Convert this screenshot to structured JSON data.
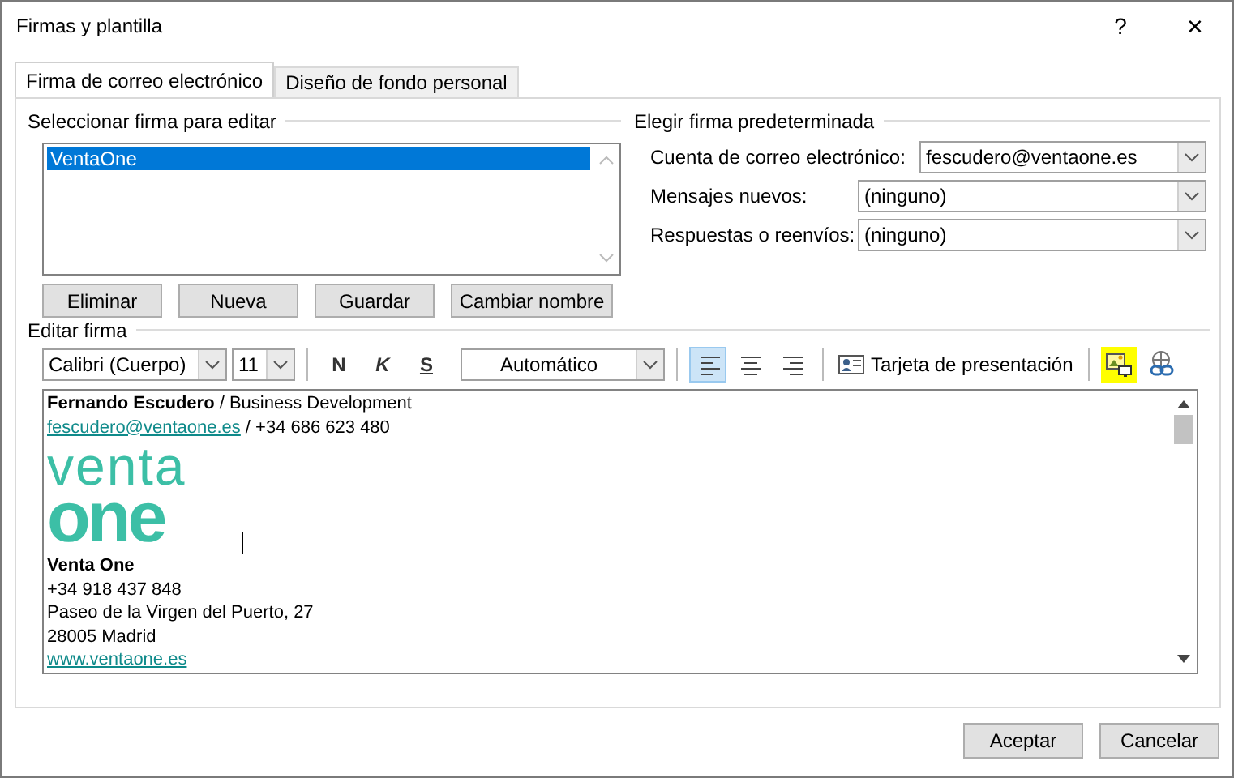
{
  "window": {
    "title": "Firmas y plantilla",
    "help": "?",
    "close": "✕"
  },
  "tabs": [
    {
      "label": "Firma de correo electrónico",
      "selected": true
    },
    {
      "label": "Diseño de fondo personal",
      "selected": false
    }
  ],
  "select_signature": {
    "label": "Seleccionar firma para editar",
    "items": [
      {
        "label": "VentaOne",
        "selected": true
      }
    ],
    "buttons": [
      "Eliminar",
      "Nueva",
      "Guardar",
      "Cambiar nombre"
    ]
  },
  "default_signature": {
    "label": "Elegir firma predeterminada",
    "fields": [
      {
        "label": "Cuenta de correo electrónico:",
        "value": "fescudero@ventaone.es"
      },
      {
        "label": "Mensajes nuevos:",
        "value": "(ninguno)"
      },
      {
        "label": "Respuestas o reenvíos:",
        "value": "(ninguno)"
      }
    ]
  },
  "edit_signature": {
    "label": "Editar firma",
    "toolbar": {
      "font": "Calibri (Cuerpo)",
      "size": "11",
      "bold": "N",
      "italic": "K",
      "underline": "S",
      "color_label": "Automático",
      "align": [
        {
          "kind": "left",
          "selected": true
        },
        {
          "kind": "center",
          "selected": false
        },
        {
          "kind": "right",
          "selected": false
        }
      ],
      "business_card": "Tarjeta de presentación",
      "picture_highlighted": true
    },
    "lines": [
      {
        "kind": "text",
        "text": "**Fernando Escudero** / Business Development"
      },
      {
        "kind": "contact",
        "link": "fescudero@ventaone.es",
        "text": "/ +34 686 623 480"
      },
      {
        "kind": "logo",
        "top": "venta",
        "bottom": "one"
      },
      {
        "kind": "text",
        "text": "Venta One",
        "bold": true
      },
      {
        "kind": "text",
        "text": "+34 918 437 848"
      },
      {
        "kind": "text",
        "text": "Paseo de la Virgen del Puerto, 27"
      },
      {
        "kind": "text",
        "text": "28005 Madrid"
      },
      {
        "kind": "link",
        "text": "www.ventaone.es"
      }
    ]
  },
  "buttons": [
    "Aceptar",
    "Cancelar"
  ]
}
